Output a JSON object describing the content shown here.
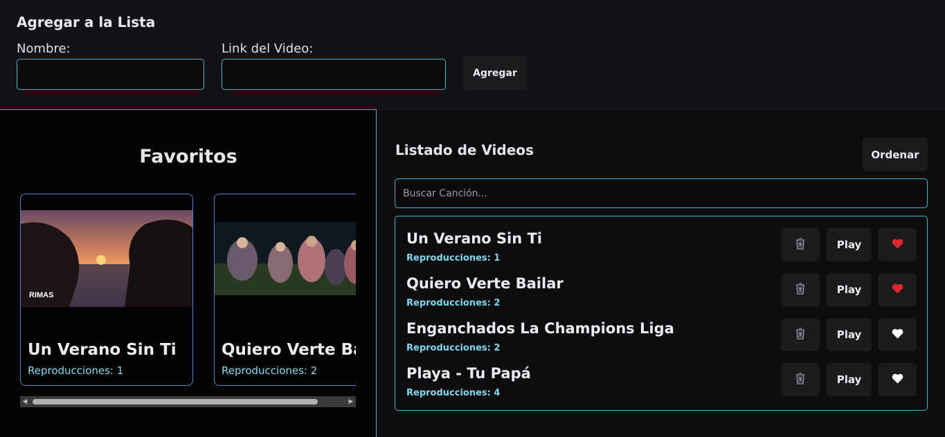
{
  "form": {
    "title": "Agregar a la Lista",
    "name_label": "Nombre:",
    "name_value": "",
    "link_label": "Link del Video:",
    "link_value": "",
    "submit_label": "Agregar"
  },
  "favorites": {
    "title": "Favoritos",
    "cards": [
      {
        "name": "Un Verano Sin Ti",
        "plays": "Reproducciones: 1",
        "thumb_text": "RIMAS"
      },
      {
        "name": "Quiero Verte Bailar",
        "plays": "Reproducciones: 2"
      }
    ]
  },
  "list": {
    "title": "Listado de Videos",
    "sort_label": "Ordenar",
    "search_placeholder": "Buscar Canción...",
    "search_value": "",
    "play_label": "Play",
    "items": [
      {
        "name": "Un Verano Sin Ti",
        "plays": "Reproducciones: 1",
        "favorite": true
      },
      {
        "name": "Quiero Verte Bailar",
        "plays": "Reproducciones: 2",
        "favorite": true
      },
      {
        "name": "Enganchados La Champions Liga",
        "plays": "Reproducciones: 2",
        "favorite": false
      },
      {
        "name": "Playa - Tu Papá",
        "plays": "Reproducciones: 4",
        "favorite": false
      }
    ]
  },
  "colors": {
    "accent": "#4fb3c9",
    "plays_text": "#88dcf0",
    "heart_favorite": "#e0262a",
    "heart_normal": "#ffffff"
  }
}
